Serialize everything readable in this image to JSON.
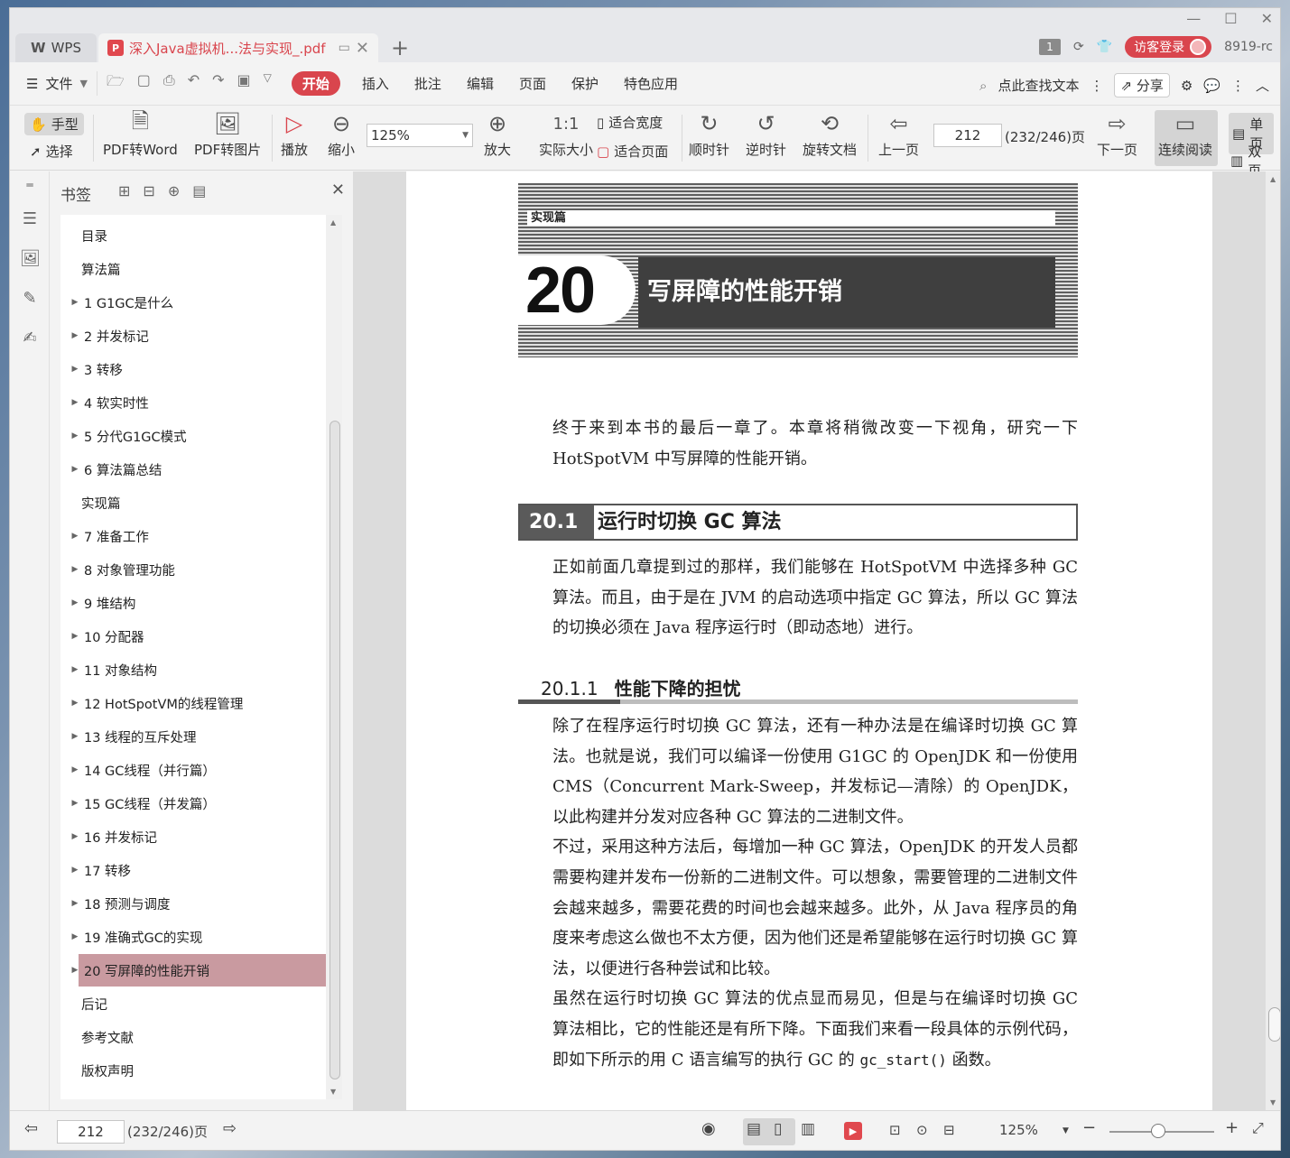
{
  "titlebar": {
    "wps_label": "WPS",
    "doc_tab_title": "深入Java虚拟机...法与实现_.pdf",
    "badge_count": "1",
    "guest_login": "访客登录",
    "user_code": "8919-rc"
  },
  "menubar": {
    "file": "文件",
    "tabs": [
      "开始",
      "插入",
      "批注",
      "编辑",
      "页面",
      "保护",
      "特色应用"
    ],
    "search": "点此查找文本",
    "share": "分享"
  },
  "toolbar": {
    "hand": "手型",
    "select": "选择",
    "pdf_to_word": "PDF转Word",
    "pdf_to_image": "PDF转图片",
    "play": "播放",
    "zoom_out": "缩小",
    "zoom_value": "125%",
    "zoom_in": "放大",
    "actual_size": "实际大小",
    "fit_width": "适合宽度",
    "fit_page": "适合页面",
    "clockwise": "顺时针",
    "counter_clockwise": "逆时针",
    "rotate_doc": "旋转文档",
    "prev_page": "上一页",
    "page_number": "212",
    "page_count": "(232/246)页",
    "next_page": "下一页",
    "continuous": "连续阅读",
    "single": "单页",
    "double": "双页"
  },
  "bookmarks": {
    "header": "书签",
    "items": [
      {
        "label": "目录",
        "arrow": false
      },
      {
        "label": "算法篇",
        "arrow": false
      },
      {
        "label": "1   G1GC是什么",
        "arrow": true
      },
      {
        "label": "2   并发标记",
        "arrow": true
      },
      {
        "label": "3   转移",
        "arrow": true
      },
      {
        "label": "4   软实时性",
        "arrow": true
      },
      {
        "label": "5   分代G1GC模式",
        "arrow": true
      },
      {
        "label": "6   算法篇总结",
        "arrow": true
      },
      {
        "label": "实现篇",
        "arrow": false
      },
      {
        "label": "7   准备工作",
        "arrow": true
      },
      {
        "label": "8   对象管理功能",
        "arrow": true
      },
      {
        "label": "9   堆结构",
        "arrow": true
      },
      {
        "label": "10   分配器",
        "arrow": true
      },
      {
        "label": "11   对象结构",
        "arrow": true
      },
      {
        "label": "12   HotSpotVM的线程管理",
        "arrow": true
      },
      {
        "label": "13   线程的互斥处理",
        "arrow": true
      },
      {
        "label": "14   GC线程（并行篇）",
        "arrow": true
      },
      {
        "label": "15   GC线程（并发篇）",
        "arrow": true
      },
      {
        "label": "16   并发标记",
        "arrow": true
      },
      {
        "label": "17   转移",
        "arrow": true
      },
      {
        "label": "18   预测与调度",
        "arrow": true
      },
      {
        "label": "19   准确式GC的实现",
        "arrow": true
      },
      {
        "label": "20   写屏障的性能开销",
        "arrow": true,
        "selected": true
      },
      {
        "label": "后记",
        "arrow": false
      },
      {
        "label": "参考文献",
        "arrow": false
      },
      {
        "label": "版权声明",
        "arrow": false
      }
    ]
  },
  "page": {
    "part_label": "实现篇",
    "chapter_number": "20",
    "chapter_title": "写屏障的性能开销",
    "intro": "终于来到本书的最后一章了。本章将稍微改变一下视角，研究一下 HotSpotVM 中写屏障的性能开销。",
    "section_number": "20.1",
    "section_title": "运行时切换 GC 算法",
    "section_para": "正如前面几章提到过的那样，我们能够在 HotSpotVM 中选择多种 GC 算法。而且，由于是在 JVM 的启动选项中指定 GC 算法，所以 GC 算法的切换必须在 Java 程序运行时（即动态地）进行。",
    "subsection_number": "20.1.1",
    "subsection_title": "性能下降的担忧",
    "para1": "除了在程序运行时切换 GC 算法，还有一种办法是在编译时切换 GC 算法。也就是说，我们可以编译一份使用 G1GC 的 OpenJDK 和一份使用 CMS（Concurrent Mark-Sweep，并发标记—清除）的 OpenJDK，以此构建并分发对应各种 GC 算法的二进制文件。",
    "para2": "不过，采用这种方法后，每增加一种 GC 算法，OpenJDK 的开发人员都需要构建并发布一份新的二进制文件。可以想象，需要管理的二进制文件会越来越多，需要花费的时间也会越来越多。此外，从 Java 程序员的角度来考虑这么做也不太方便，因为他们还是希望能够在运行时切换 GC 算法，以便进行各种尝试和比较。",
    "para3_a": "虽然在运行时切换 GC 算法的优点显而易见，但是与在编译时切换 GC 算法相比，它的性能还是有所下降。下面我们来看一段具体的示例代码，即如下所示的用 C 语言编写的执行 GC 的 ",
    "para3_code": "gc_start()",
    "para3_b": " 函数。"
  },
  "statusbar": {
    "page_number": "212",
    "page_count": "(232/246)页",
    "zoom": "125%"
  }
}
